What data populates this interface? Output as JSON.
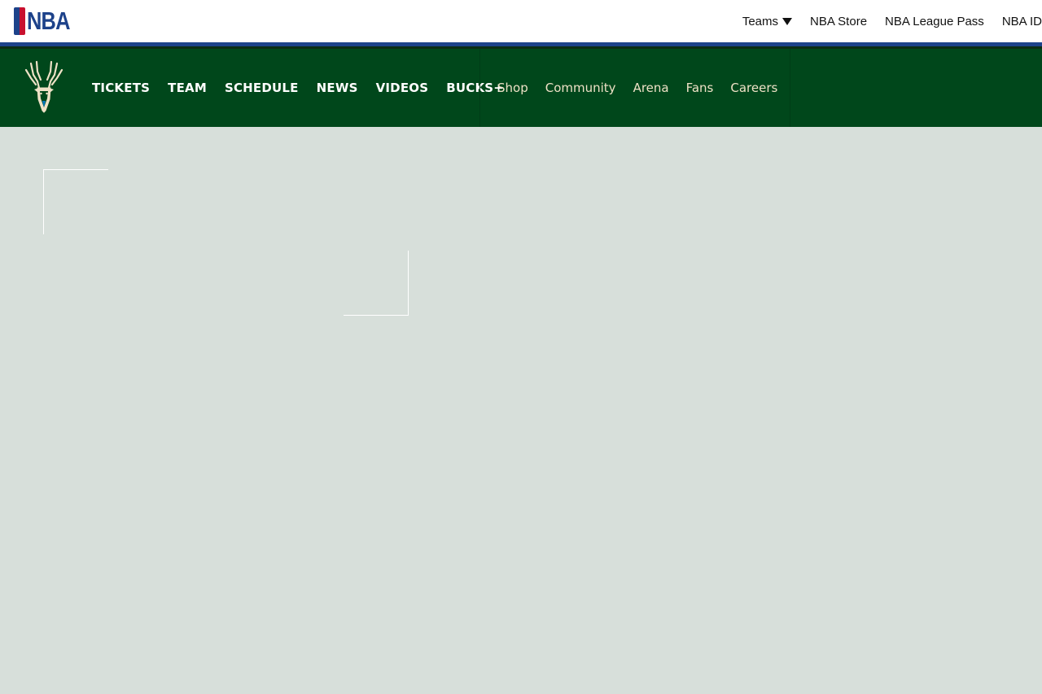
{
  "nba_bar": {
    "logo_text": "NBA",
    "links": {
      "teams": "Teams",
      "store": "NBA Store",
      "league_pass": "NBA League Pass",
      "nba_id": "NBA ID"
    }
  },
  "team_nav": {
    "logo_icon": "bucks-deer-icon",
    "primary": [
      "TICKETS",
      "TEAM",
      "SCHEDULE",
      "NEWS",
      "VIDEOS",
      "BUCKS+"
    ],
    "secondary": [
      "Shop",
      "Community",
      "Arena",
      "Fans",
      "Careers"
    ]
  },
  "colors": {
    "nba_blue": "#1d428a",
    "nba_red": "#c8102e",
    "bucks_green": "#00471b",
    "bucks_cream": "#eee1c6",
    "page_background": "#d7dfda"
  }
}
